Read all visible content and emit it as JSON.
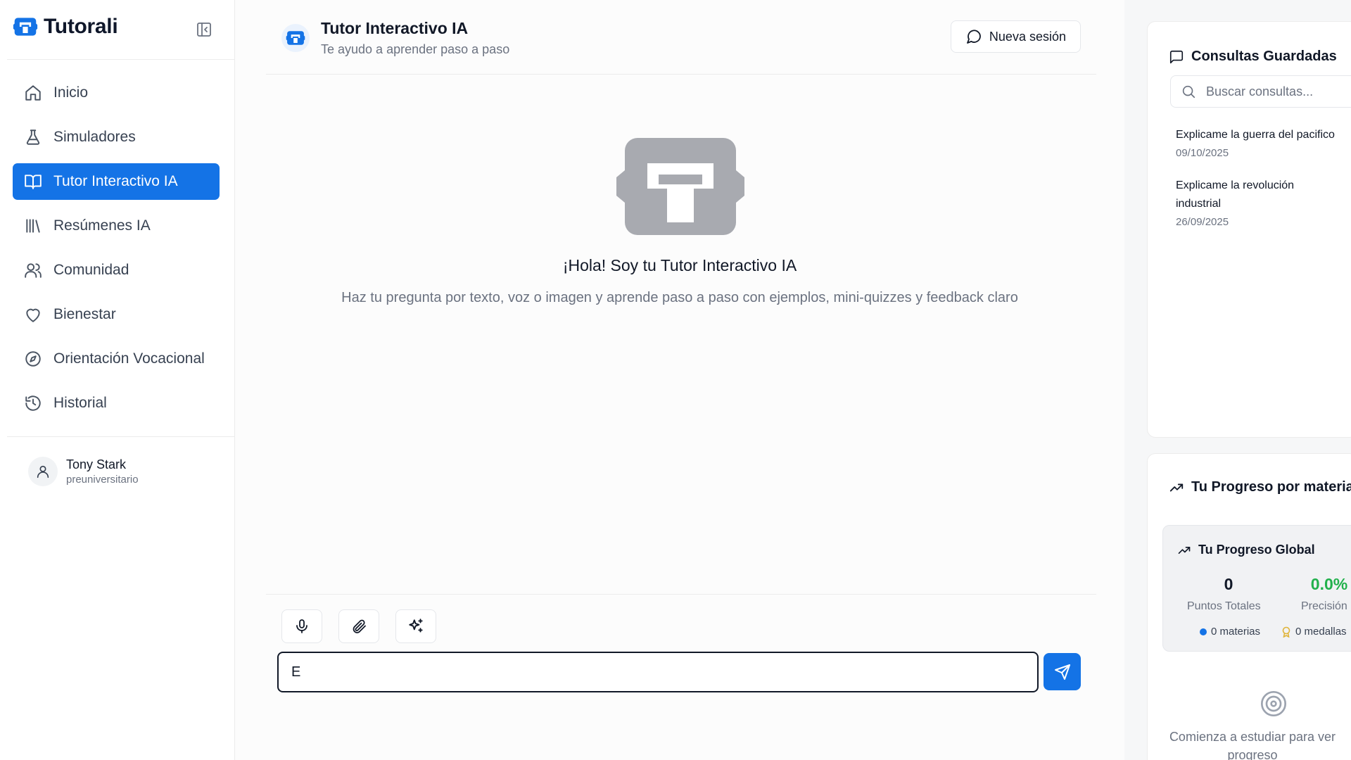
{
  "brand": {
    "name": "Tutorali"
  },
  "sidebar": {
    "items": [
      {
        "label": "Inicio",
        "icon": "home-icon"
      },
      {
        "label": "Simuladores",
        "icon": "flask-icon"
      },
      {
        "label": "Tutor Interactivo IA",
        "icon": "book-open-icon",
        "active": true
      },
      {
        "label": "Resúmenes IA",
        "icon": "library-icon"
      },
      {
        "label": "Comunidad",
        "icon": "users-icon"
      },
      {
        "label": "Bienestar",
        "icon": "heart-icon"
      },
      {
        "label": "Orientación Vocacional",
        "icon": "compass-icon"
      },
      {
        "label": "Historial",
        "icon": "history-icon"
      }
    ],
    "user": {
      "name": "Tony Stark",
      "role": "preuniversitario"
    }
  },
  "header": {
    "title": "Tutor Interactivo IA",
    "subtitle": "Te ayudo a aprender paso a paso",
    "new_session_label": "Nueva sesión"
  },
  "welcome": {
    "title": "¡Hola! Soy tu Tutor Interactivo IA",
    "subtitle": "Haz tu pregunta por texto, voz o imagen y aprende paso a paso con ejemplos, mini-quizzes y feedback claro"
  },
  "composer": {
    "input_value": "E",
    "tools": [
      "microphone-icon",
      "paperclip-icon",
      "sparkles-icon"
    ]
  },
  "saved": {
    "title": "Consultas Guardadas",
    "search_placeholder": "Buscar consultas...",
    "queries": [
      {
        "title": "Explicame la guerra del pacifico",
        "date": "09/10/2025"
      },
      {
        "title": "Explicame la revolución industrial",
        "date": "26/09/2025"
      }
    ]
  },
  "progress": {
    "title": "Tu Progreso por materia",
    "global_title": "Tu Progreso Global",
    "points_value": "0",
    "points_label": "Puntos Totales",
    "precision_value": "0.0%",
    "precision_label": "Precisión",
    "subjects": "0 materias",
    "medals": "0 medallas",
    "empty_message": "Comienza a estudiar para ver progreso"
  },
  "colors": {
    "accent": "#1473e6",
    "success": "#22b14c",
    "muted": "#6b7280"
  }
}
